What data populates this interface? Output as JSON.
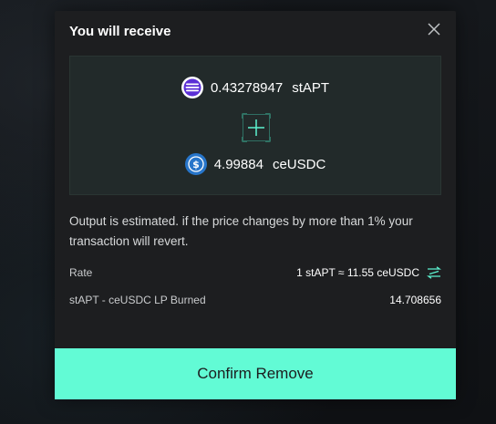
{
  "modal": {
    "title": "You will receive",
    "close_icon": "close-icon"
  },
  "receive": {
    "token_a": {
      "amount": "0.43278947",
      "symbol": "stAPT",
      "icon": "stapt-token-icon",
      "color": "#5b2fd6"
    },
    "plus_icon": "plus-icon",
    "token_b": {
      "amount": "4.99884",
      "symbol": "ceUSDC",
      "icon": "usdc-token-icon",
      "color": "#2775ca"
    }
  },
  "note": "Output is estimated. if the price changes by more than 1% your transaction will revert.",
  "details": {
    "rate_label": "Rate",
    "rate_value": "1 stAPT ≈ 11.55 ceUSDC",
    "rate_icon": "swap-direction-icon",
    "lp_label": "stAPT - ceUSDC LP Burned",
    "lp_value": "14.708656"
  },
  "actions": {
    "confirm_label": "Confirm Remove"
  },
  "colors": {
    "accent": "#62fbd5",
    "modal_bg": "#1d1e20",
    "box_bg": "#222a2a"
  }
}
